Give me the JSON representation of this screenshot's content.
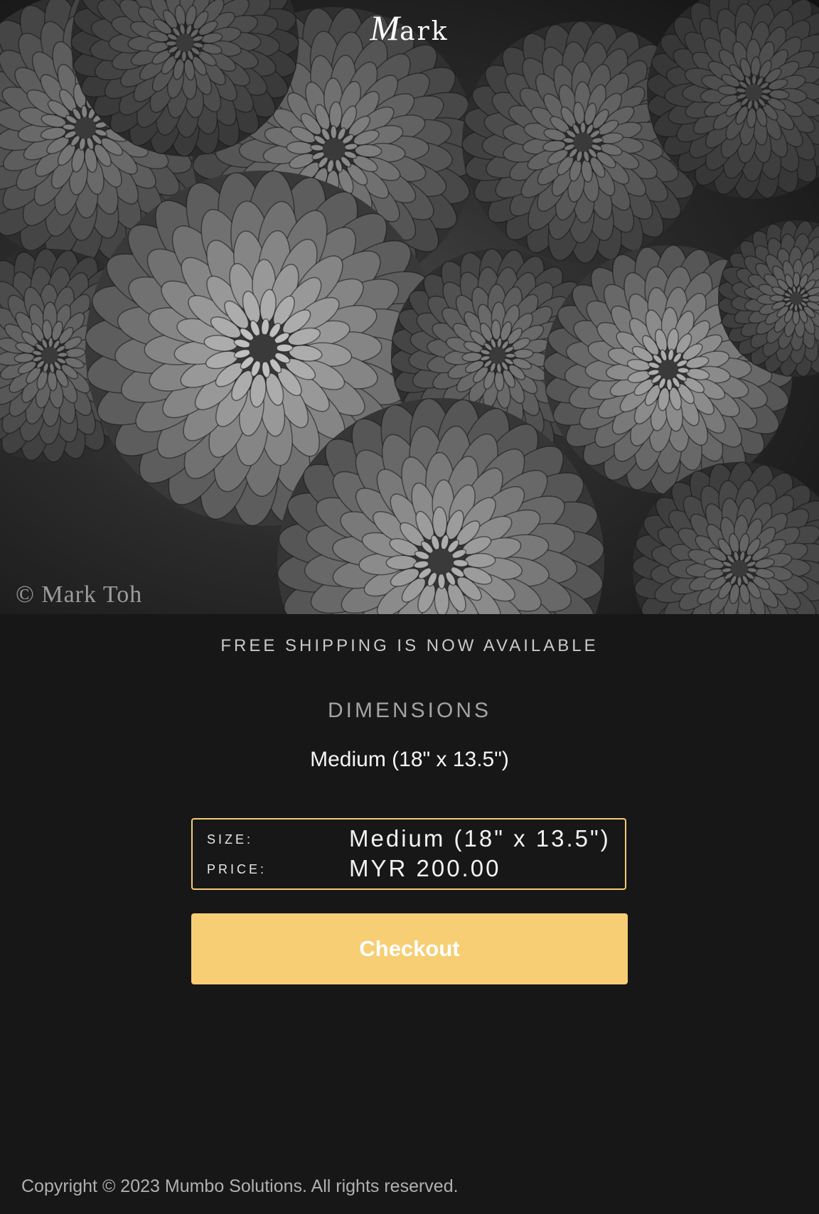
{
  "header": {
    "brand_initial": "M",
    "brand_rest": "ark"
  },
  "hero": {
    "image_subject": "black-and-white close-up of chrysanthemum flowers",
    "watermark": "© Mark Toh"
  },
  "product": {
    "shipping_notice": "FREE SHIPPING IS NOW AVAILABLE",
    "dimensions_heading": "DIMENSIONS",
    "selected_dimension": "Medium (18\" x 13.5\")"
  },
  "summary": {
    "size_label": "SIZE:",
    "size_value": "Medium (18\" x 13.5\")",
    "price_label": "PRICE:",
    "price_value": "MYR 200.00"
  },
  "actions": {
    "checkout_label": "Checkout"
  },
  "footer": {
    "copyright": "Copyright © 2023 Mumbo Solutions. All rights reserved."
  },
  "colors": {
    "background": "#171717",
    "accent": "#f7ce74",
    "accent_border": "#f4cd74",
    "muted_text": "#a3a3a3"
  }
}
